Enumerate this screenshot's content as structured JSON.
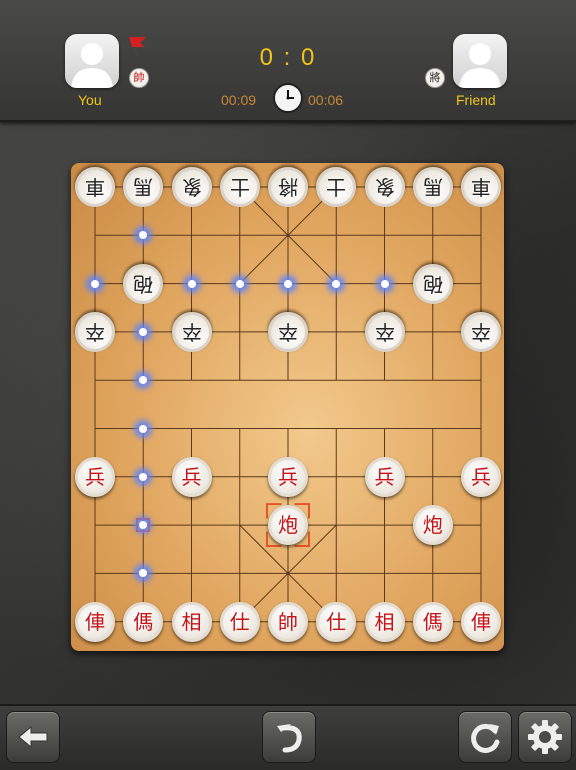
{
  "players": {
    "left": {
      "name": "You",
      "side_char": "帥"
    },
    "right": {
      "name": "Friend",
      "side_char": "將"
    }
  },
  "score": "0 : 0",
  "timers": {
    "left": "00:09",
    "right": "00:06"
  },
  "colors": {
    "accent": "#f0c418",
    "timer": "#c8863a",
    "red_piece": "#c4141a",
    "highlight": "#5a82ff"
  },
  "icons": [
    "user-avatar-icon",
    "turn-flag-icon",
    "clock-icon",
    "back-arrow-icon",
    "undo-icon",
    "restart-icon",
    "settings-gear-icon"
  ],
  "board": {
    "pieces": [
      {
        "char": "車",
        "color": "black",
        "c": 0,
        "r": 0
      },
      {
        "char": "馬",
        "color": "black",
        "c": 1,
        "r": 0
      },
      {
        "char": "象",
        "color": "black",
        "c": 2,
        "r": 0
      },
      {
        "char": "士",
        "color": "black",
        "c": 3,
        "r": 0
      },
      {
        "char": "將",
        "color": "black",
        "c": 4,
        "r": 0
      },
      {
        "char": "士",
        "color": "black",
        "c": 5,
        "r": 0
      },
      {
        "char": "象",
        "color": "black",
        "c": 6,
        "r": 0
      },
      {
        "char": "馬",
        "color": "black",
        "c": 7,
        "r": 0
      },
      {
        "char": "車",
        "color": "black",
        "c": 8,
        "r": 0
      },
      {
        "char": "砲",
        "color": "black",
        "c": 1,
        "r": 2
      },
      {
        "char": "砲",
        "color": "black",
        "c": 7,
        "r": 2
      },
      {
        "char": "卒",
        "color": "black",
        "c": 0,
        "r": 3
      },
      {
        "char": "卒",
        "color": "black",
        "c": 2,
        "r": 3
      },
      {
        "char": "卒",
        "color": "black",
        "c": 4,
        "r": 3
      },
      {
        "char": "卒",
        "color": "black",
        "c": 6,
        "r": 3
      },
      {
        "char": "卒",
        "color": "black",
        "c": 8,
        "r": 3
      },
      {
        "char": "兵",
        "color": "red",
        "c": 0,
        "r": 6
      },
      {
        "char": "兵",
        "color": "red",
        "c": 2,
        "r": 6
      },
      {
        "char": "兵",
        "color": "red",
        "c": 4,
        "r": 6
      },
      {
        "char": "兵",
        "color": "red",
        "c": 6,
        "r": 6
      },
      {
        "char": "兵",
        "color": "red",
        "c": 8,
        "r": 6
      },
      {
        "char": "炮",
        "color": "red",
        "c": 4,
        "r": 7
      },
      {
        "char": "炮",
        "color": "red",
        "c": 7,
        "r": 7
      },
      {
        "char": "俥",
        "color": "red",
        "c": 0,
        "r": 9
      },
      {
        "char": "傌",
        "color": "red",
        "c": 1,
        "r": 9
      },
      {
        "char": "相",
        "color": "red",
        "c": 2,
        "r": 9
      },
      {
        "char": "仕",
        "color": "red",
        "c": 3,
        "r": 9
      },
      {
        "char": "帥",
        "color": "red",
        "c": 4,
        "r": 9
      },
      {
        "char": "仕",
        "color": "red",
        "c": 5,
        "r": 9
      },
      {
        "char": "相",
        "color": "red",
        "c": 6,
        "r": 9
      },
      {
        "char": "傌",
        "color": "red",
        "c": 7,
        "r": 9
      },
      {
        "char": "俥",
        "color": "red",
        "c": 8,
        "r": 9
      }
    ],
    "selected": {
      "c": 4,
      "r": 7
    },
    "last_move_origin": {
      "c": 1,
      "r": 7
    },
    "legal_moves": [
      {
        "c": 1,
        "r": 1
      },
      {
        "c": 0,
        "r": 2
      },
      {
        "c": 2,
        "r": 2
      },
      {
        "c": 3,
        "r": 2
      },
      {
        "c": 4,
        "r": 2
      },
      {
        "c": 5,
        "r": 2
      },
      {
        "c": 6,
        "r": 2
      },
      {
        "c": 1,
        "r": 3
      },
      {
        "c": 1,
        "r": 4
      },
      {
        "c": 1,
        "r": 5
      },
      {
        "c": 1,
        "r": 6
      },
      {
        "c": 1,
        "r": 7
      },
      {
        "c": 1,
        "r": 8
      }
    ]
  }
}
